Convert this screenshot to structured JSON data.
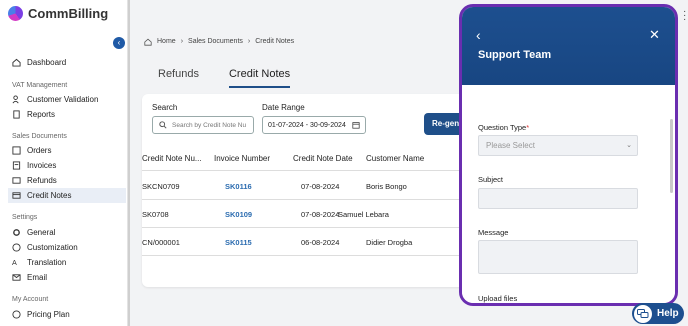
{
  "brand": {
    "name": "CommBilling"
  },
  "colors": {
    "accent": "#1d4f8f",
    "highlight": "#6a2eb0",
    "link": "#2b6cb0"
  },
  "sidebar": {
    "dashboard": "Dashboard",
    "groups": {
      "vat": "VAT Management",
      "sales": "Sales Documents",
      "settings": "Settings",
      "account": "My Account"
    },
    "items": {
      "customer_validation": "Customer Validation",
      "reports": "Reports",
      "orders": "Orders",
      "invoices": "Invoices",
      "refunds": "Refunds",
      "credit_notes": "Credit Notes",
      "general": "General",
      "customization": "Customization",
      "translation": "Translation",
      "email": "Email",
      "pricing_plan": "Pricing Plan"
    }
  },
  "breadcrumb": {
    "home": "Home",
    "sep": "›",
    "section": "Sales Documents",
    "page": "Credit Notes"
  },
  "tabs": [
    {
      "label": "Refunds"
    },
    {
      "label": "Credit Notes",
      "active": true
    }
  ],
  "filters": {
    "search_label": "Search",
    "search_placeholder": "Search by Credit Note Nu",
    "date_label": "Date Range",
    "date_value": "01-07-2024 - 30-09-2024",
    "regen_button": "Re-gen"
  },
  "table": {
    "headers": [
      "Credit Note Nu...",
      "Invoice Number",
      "Credit Note Date",
      "Customer Name"
    ],
    "rows": [
      [
        "SKCN0709",
        "SK0116",
        "07-08-2024",
        "Boris Bongo"
      ],
      [
        "SK0708",
        "SK0109",
        "07-08-2024",
        "Samuel Lebara"
      ],
      [
        "CN/000001",
        "SK0115",
        "06-08-2024",
        "Didier Drogba"
      ]
    ]
  },
  "panel": {
    "title": "Support Team",
    "question_type_label": "Question Type",
    "required_mark": "*",
    "question_type_placeholder": "Please Select",
    "subject_label": "Subject",
    "message_label": "Message",
    "upload_label": "Upload files"
  },
  "help": {
    "label": "Help"
  }
}
